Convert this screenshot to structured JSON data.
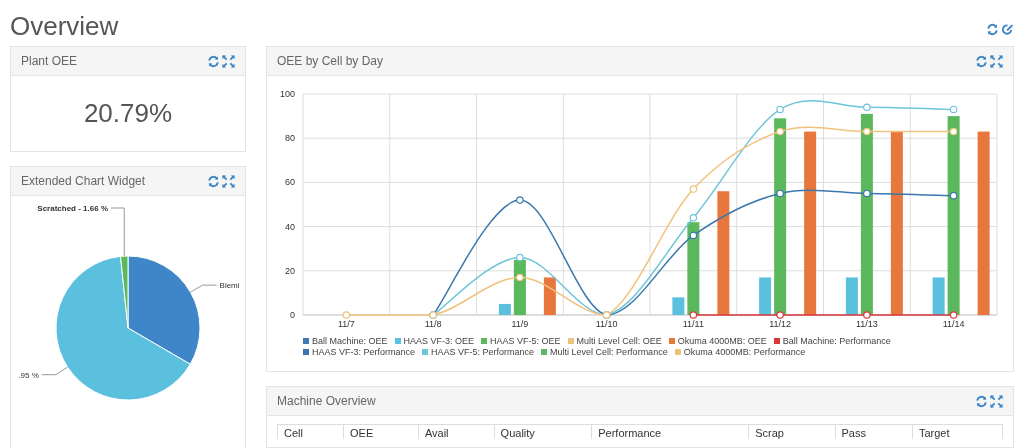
{
  "page_title": "Overview",
  "plant_oee": {
    "title": "Plant OEE",
    "value": "20.79%"
  },
  "extended_chart": {
    "title": "Extended Chart Widget",
    "chart_data": {
      "type": "pie",
      "categories": [
        "Blemi",
        ".95 %",
        "Scratched - 1.66 %"
      ],
      "values": [
        33.39,
        64.95,
        1.66
      ],
      "colors": [
        "#3f86c8",
        "#5bbfde",
        "#5cb85c"
      ]
    }
  },
  "oee_chart": {
    "title": "OEE by Cell by Day",
    "chart_data": {
      "type": "bar",
      "categories": [
        "11/7",
        "11/8",
        "11/9",
        "11/10",
        "11/11",
        "11/12",
        "11/13",
        "11/14"
      ],
      "ylim": [
        0,
        100
      ],
      "grid": true,
      "yticks": [
        0,
        20,
        40,
        60,
        80,
        100
      ],
      "series": [
        {
          "name": "Ball Machine: OEE",
          "color": "#3f79b5",
          "type": "bar",
          "values": [
            0,
            0,
            0,
            0,
            0,
            0,
            0,
            0
          ]
        },
        {
          "name": "HAAS VF-3: OEE",
          "color": "#5bc0de",
          "type": "bar",
          "values": [
            0,
            0,
            5,
            0,
            8,
            17,
            17,
            17
          ]
        },
        {
          "name": "HAAS VF-5: OEE",
          "color": "#5cb85c",
          "type": "bar",
          "values": [
            0,
            0,
            25,
            0,
            42,
            89,
            91,
            90
          ]
        },
        {
          "name": "Multi Level Cell: OEE",
          "color": "#f0c27b",
          "type": "bar",
          "values": [
            0,
            0,
            0,
            0,
            0,
            0,
            0,
            0
          ]
        },
        {
          "name": "Okuma 4000MB: OEE",
          "color": "#e8773d",
          "type": "bar",
          "values": [
            0,
            0,
            17,
            0,
            56,
            83,
            83,
            83
          ]
        },
        {
          "name": "Ball Machine: Performance",
          "color": "#d9363e",
          "type": "line",
          "marker": true,
          "values": [
            null,
            null,
            null,
            null,
            0,
            0,
            0,
            0
          ]
        },
        {
          "name": "HAAS VF-3: Performance",
          "color": "#3a78ad",
          "type": "line",
          "marker": true,
          "values": [
            null,
            0,
            52,
            0,
            36,
            55,
            55,
            54
          ]
        },
        {
          "name": "HAAS VF-5: Performance",
          "color": "#6ec4d9",
          "type": "line",
          "marker": true,
          "values": [
            null,
            0,
            26,
            0,
            44,
            93,
            94,
            93
          ]
        },
        {
          "name": "Multi Level Cell: Performance",
          "color": "#5cb85c",
          "type": "line",
          "values": [
            null,
            null,
            null,
            null,
            null,
            null,
            null,
            null
          ]
        },
        {
          "name": "Okuma 4000MB: Performance",
          "color": "#f0c27b",
          "type": "line",
          "marker": true,
          "values": [
            0,
            0,
            17,
            0,
            57,
            83,
            83,
            83
          ]
        }
      ]
    }
  },
  "machine_overview": {
    "title": "Machine Overview",
    "table": {
      "columns": [
        "Cell",
        "OEE",
        "Avail",
        "Quality",
        "Performance",
        "Scrap",
        "Pass",
        "Target"
      ]
    }
  }
}
